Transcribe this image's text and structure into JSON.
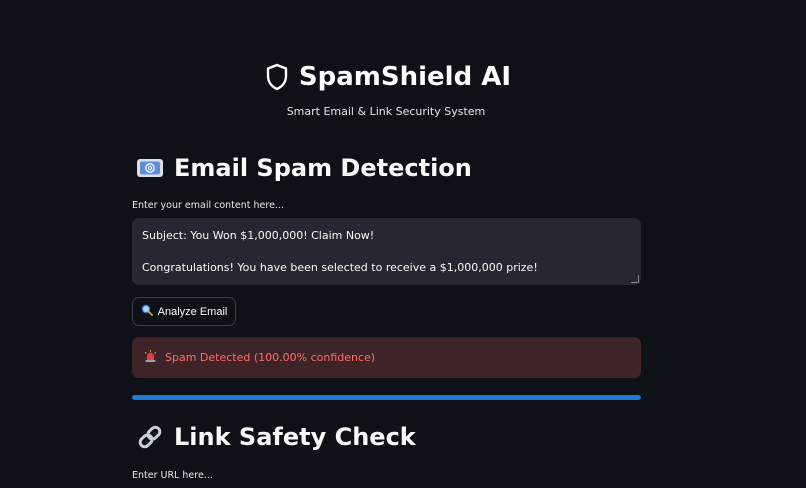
{
  "app": {
    "title": "SpamShield AI",
    "subtitle": "Smart Email & Link Security System",
    "icon": "shield-icon"
  },
  "email_section": {
    "heading": "Email Spam Detection",
    "icon": "email-icon",
    "input_label": "Enter your email content here...",
    "content_lines": [
      "Subject: You Won $1,000,000! Claim Now!",
      "",
      "Congratulations! You have been selected to receive a $1,000,000 prize!"
    ],
    "analyze_button": {
      "label": "Analyze Email",
      "icon": "magnifier-icon"
    },
    "result": {
      "text": "Spam Detected (100.00% confidence)",
      "icon": "siren-icon",
      "color": "#ff6b6b"
    },
    "confidence": {
      "value": 1.0
    }
  },
  "link_section": {
    "heading": "Link Safety Check",
    "icon": "link-icon",
    "input_label": "Enter URL here..."
  },
  "colors": {
    "background": "#0e1117",
    "input_background": "#262730",
    "error_background": "#3e2427",
    "progress": "#1f7ad4"
  }
}
